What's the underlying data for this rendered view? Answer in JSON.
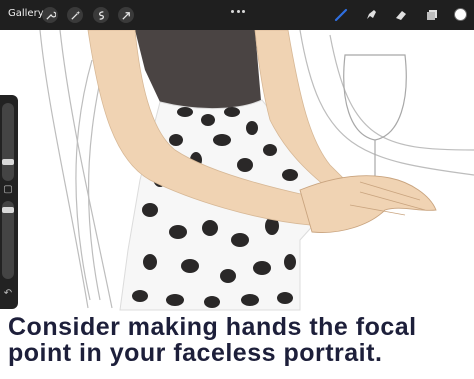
{
  "toolbar": {
    "gallery_label": "Gallery",
    "left_tools": [
      "wrench-icon",
      "magic-wand-icon",
      "selection-icon",
      "transform-arrow-icon"
    ],
    "right_tools": [
      "brush-icon",
      "smudge-icon",
      "eraser-icon",
      "layers-icon"
    ],
    "active_tool": "brush-icon",
    "accent_color": "#2f6fe0",
    "current_color": "#ffffff"
  },
  "sidebar": {
    "controls": [
      "brush-size-slider",
      "modify-button",
      "opacity-slider",
      "undo-button"
    ]
  },
  "caption": {
    "line1": "Consider making hands the focal",
    "line2": "point in your faceless portrait."
  },
  "colors": {
    "skin": "#f0d3b3",
    "top": "#4a4443",
    "spots": "#2a2828",
    "ui_dark": "#1f1f1f",
    "caption_text": "#1d1f3a"
  }
}
